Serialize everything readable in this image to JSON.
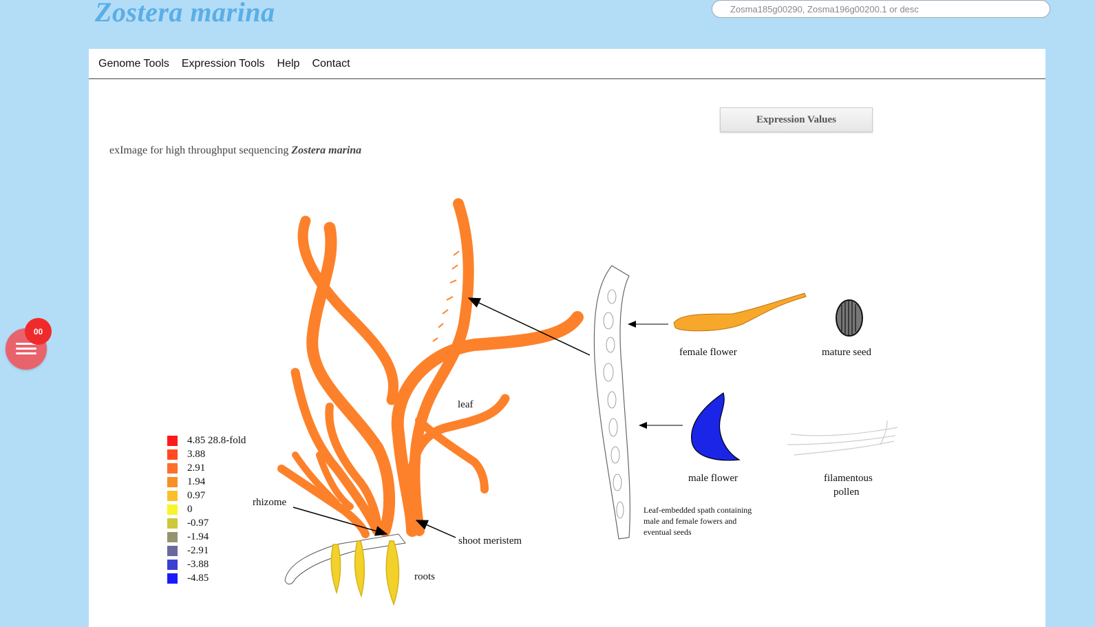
{
  "header": {
    "site_title": "Zostera marina",
    "search_placeholder": "Zosma185g00290, Zosma196g00200.1 or desc"
  },
  "nav": {
    "items": [
      "Genome Tools",
      "Expression Tools",
      "Help",
      "Contact"
    ]
  },
  "main": {
    "expression_button": "Expression Values",
    "subtitle_prefix": "exImage for high throughput sequencing ",
    "subtitle_species": "Zostera marina"
  },
  "diagram_labels": {
    "leaf": "leaf",
    "rhizome": "rhizome",
    "shoot_meristem": "shoot meristem",
    "roots": "roots",
    "female_flower": "female flower",
    "mature_seed": "mature seed",
    "male_flower": "male flower",
    "filamentous_pollen_1": "filamentous",
    "filamentous_pollen_2": "pollen",
    "spath_1": "Leaf-embedded spath containing",
    "spath_2": "male and female fowers and",
    "spath_3": "eventual seeds"
  },
  "legend": [
    {
      "label": "4.85 28.8-fold",
      "color": "#ff1a1a"
    },
    {
      "label": "3.88",
      "color": "#ff4a22"
    },
    {
      "label": "2.91",
      "color": "#fd6f2a"
    },
    {
      "label": "1.94",
      "color": "#f98f2a"
    },
    {
      "label": "0.97",
      "color": "#fbbf2a"
    },
    {
      "label": "0",
      "color": "#f7f52a"
    },
    {
      "label": "-0.97",
      "color": "#cdc93a"
    },
    {
      "label": "-1.94",
      "color": "#969470"
    },
    {
      "label": "-2.91",
      "color": "#6a6a9c"
    },
    {
      "label": "-3.88",
      "color": "#3b40d0"
    },
    {
      "label": "-4.85",
      "color": "#1a1aff"
    }
  ],
  "colors": {
    "leaf": "#fd812a",
    "roots": "#f2d12a",
    "female_flower": "#f7a82a",
    "male_flower": "#1a25e8",
    "background": "#b3dcf7"
  },
  "widget": {
    "badge": "00",
    "icon": "hamburger-menu-icon"
  }
}
